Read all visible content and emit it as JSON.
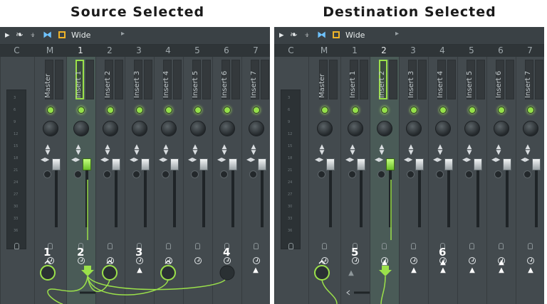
{
  "titles": {
    "left": "Source Selected",
    "right": "Destination Selected"
  },
  "toolbar": {
    "preset_label": "Wide"
  },
  "columns": [
    "C",
    "M",
    "1",
    "2",
    "3",
    "4",
    "5",
    "6",
    "7"
  ],
  "meter_ticks": [
    "3",
    "6",
    "9",
    "12",
    "15",
    "18",
    "21",
    "24",
    "27",
    "30",
    "33",
    "36"
  ],
  "strips": {
    "master": "Master",
    "inserts": [
      "Insert 1",
      "Insert 2",
      "Insert 3",
      "Insert 4",
      "Insert 5",
      "Insert 6",
      "Insert 7"
    ]
  },
  "callouts": {
    "left": [
      "1",
      "2",
      "3",
      "4"
    ],
    "right": [
      "5",
      "6"
    ]
  },
  "colors": {
    "accent_green": "#9be14a",
    "mixer_bg": "#3e4549",
    "selected_strip": "#4a5b57"
  },
  "icons": [
    "play-icon",
    "bird-icon",
    "pin-icon",
    "bowtie-icon",
    "box-icon",
    "chevron-right-icon",
    "mic-icon",
    "clock-icon",
    "route-arrow-icon"
  ],
  "selection": {
    "left_selected_strip": "1",
    "right_selected_strip": "2"
  }
}
